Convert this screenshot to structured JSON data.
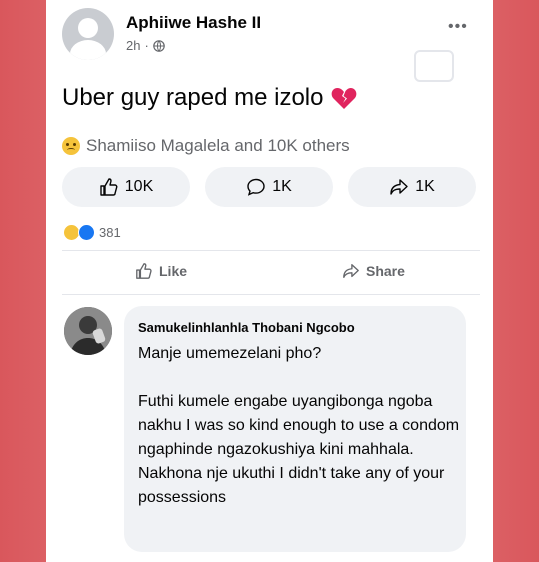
{
  "post": {
    "author": "Aphiiwe Hashe II",
    "time": "2h",
    "separator": "·",
    "text": "Uber guy raped me izolo",
    "reactors": "Shamiiso Magalela and 10K others"
  },
  "actions_pills": {
    "likes": "10K",
    "comments": "1K",
    "shares": "1K"
  },
  "stats": {
    "reactions_count": "381"
  },
  "actions": {
    "like_label": "Like",
    "share_label": "Share"
  },
  "comment": {
    "author": "Samukelinhlanhla Thobani Ngcobo",
    "line1": "Manje umemezelani pho?",
    "line2": "Futhi kumele engabe uyangibonga ngoba nakhu I was so kind enough to use a condom ngaphinde ngazokushiya kini mahhala. Nakhona nje ukuthi I didn't take any of your possessions"
  },
  "colors": {
    "background": "#d9575c",
    "card": "#ffffff",
    "bubble": "#f0f2f5",
    "secondary_text": "#65676b",
    "broken_heart": "#e0245e",
    "reaction_sad": "#f5c33b",
    "reaction_like": "#1877f2"
  },
  "icons": {
    "broken_heart": "broken-heart-icon",
    "globe": "globe-icon",
    "like": "thumbs-up-icon",
    "comment": "comment-icon",
    "share": "share-icon",
    "more": "more-icon"
  }
}
